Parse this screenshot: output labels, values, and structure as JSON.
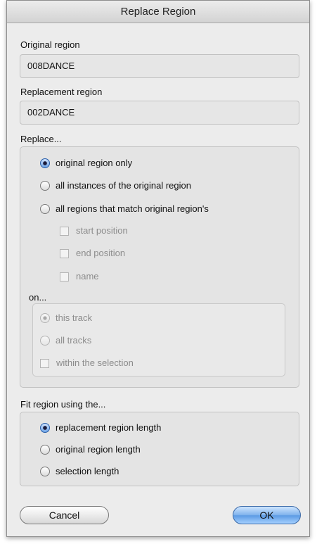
{
  "window": {
    "title": "Replace Region"
  },
  "original": {
    "label": "Original region",
    "value": "008DANCE"
  },
  "replacement": {
    "label": "Replacement region",
    "value": "002DANCE"
  },
  "replace": {
    "label": "Replace...",
    "options": [
      {
        "label": "original region only",
        "selected": true
      },
      {
        "label": "all instances of the original region",
        "selected": false
      },
      {
        "label": "all regions that match original region's",
        "selected": false
      }
    ],
    "match_criteria": [
      {
        "label": "start position",
        "checked": false
      },
      {
        "label": "end position",
        "checked": false
      },
      {
        "label": "name",
        "checked": false
      }
    ],
    "on": {
      "label": "on...",
      "options": [
        {
          "label": "this track",
          "selected": true
        },
        {
          "label": "all tracks",
          "selected": false
        }
      ],
      "within_selection": {
        "label": "within the selection",
        "checked": false
      }
    }
  },
  "fit": {
    "label": "Fit region using the...",
    "options": [
      {
        "label": "replacement region length",
        "selected": true
      },
      {
        "label": "original region length",
        "selected": false
      },
      {
        "label": "selection length",
        "selected": false
      }
    ]
  },
  "buttons": {
    "cancel": "Cancel",
    "ok": "OK"
  }
}
